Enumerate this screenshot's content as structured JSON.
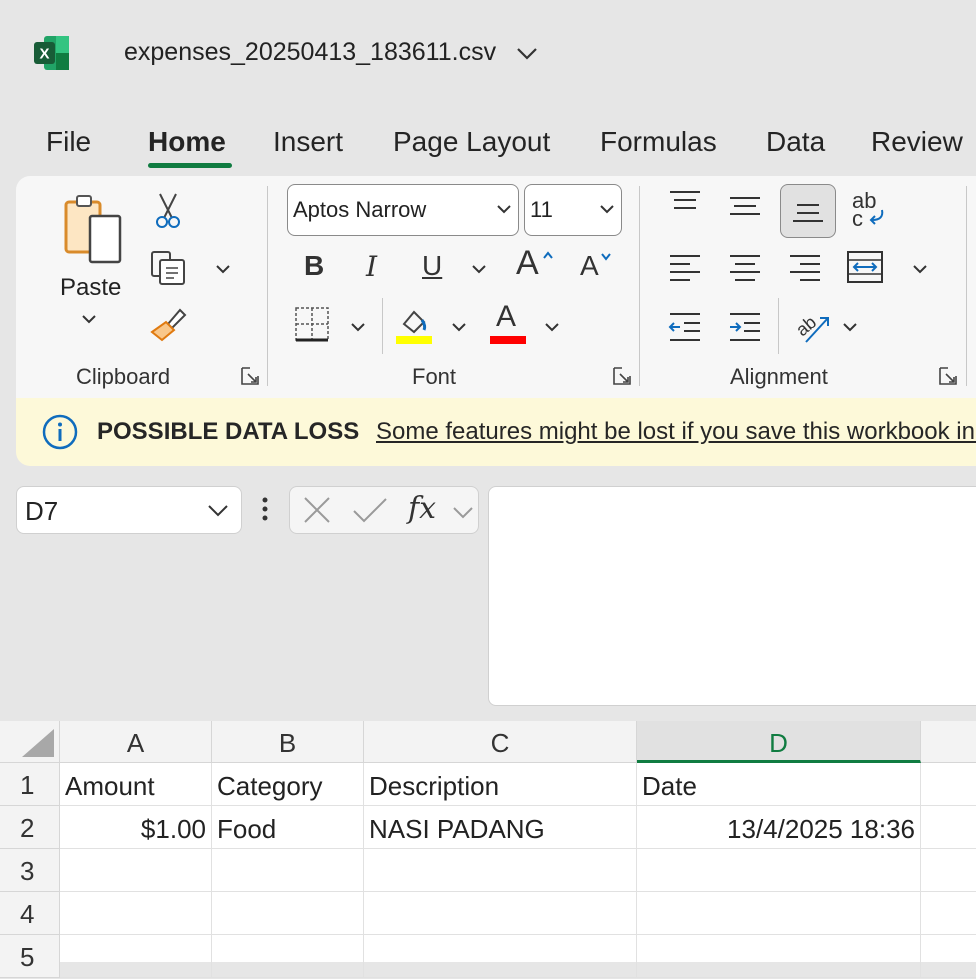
{
  "window": {
    "file_name": "expenses_20250413_183611.csv",
    "app_icon": "excel-icon"
  },
  "tabs": [
    "File",
    "Home",
    "Insert",
    "Page Layout",
    "Formulas",
    "Data",
    "Review"
  ],
  "active_tab": "Home",
  "ribbon": {
    "clipboard": {
      "label": "Clipboard",
      "paste_label": "Paste",
      "icons": [
        "paste-icon",
        "cut-icon",
        "copy-icon",
        "format-painter-icon"
      ]
    },
    "font": {
      "label": "Font",
      "font_name": "Aptos Narrow",
      "font_size": "11",
      "bold": "B",
      "italic": "I",
      "underline": "U",
      "grow": "A",
      "shrink": "A",
      "font_color_glyph": "A",
      "highlight_color": "#ffff00",
      "font_color": "#ff0000"
    },
    "alignment": {
      "label": "Alignment",
      "wrap_glyph_top": "ab",
      "wrap_glyph_bottom": "c"
    }
  },
  "banner": {
    "title": "POSSIBLE DATA LOSS",
    "message": "Some features might be lost if you save this workbook in the comma-delimited (.csv) format."
  },
  "formula_bar": {
    "name_box": "D7",
    "fx": "fx",
    "formula": ""
  },
  "sheet": {
    "columns": [
      "A",
      "B",
      "C",
      "D"
    ],
    "selected_column": "D",
    "rows": [
      {
        "num": "1",
        "cells": [
          "Amount",
          "Category",
          "Description",
          "Date"
        ]
      },
      {
        "num": "2",
        "cells": [
          "$1.00",
          "Food",
          "NASI PADANG",
          "13/4/2025 18:36"
        ]
      },
      {
        "num": "3",
        "cells": [
          "",
          "",
          "",
          ""
        ]
      },
      {
        "num": "4",
        "cells": [
          "",
          "",
          "",
          ""
        ]
      },
      {
        "num": "5",
        "cells": [
          "",
          "",
          "",
          ""
        ]
      }
    ]
  },
  "colors": {
    "accent": "#107c41",
    "info": "#0f6cbd"
  }
}
